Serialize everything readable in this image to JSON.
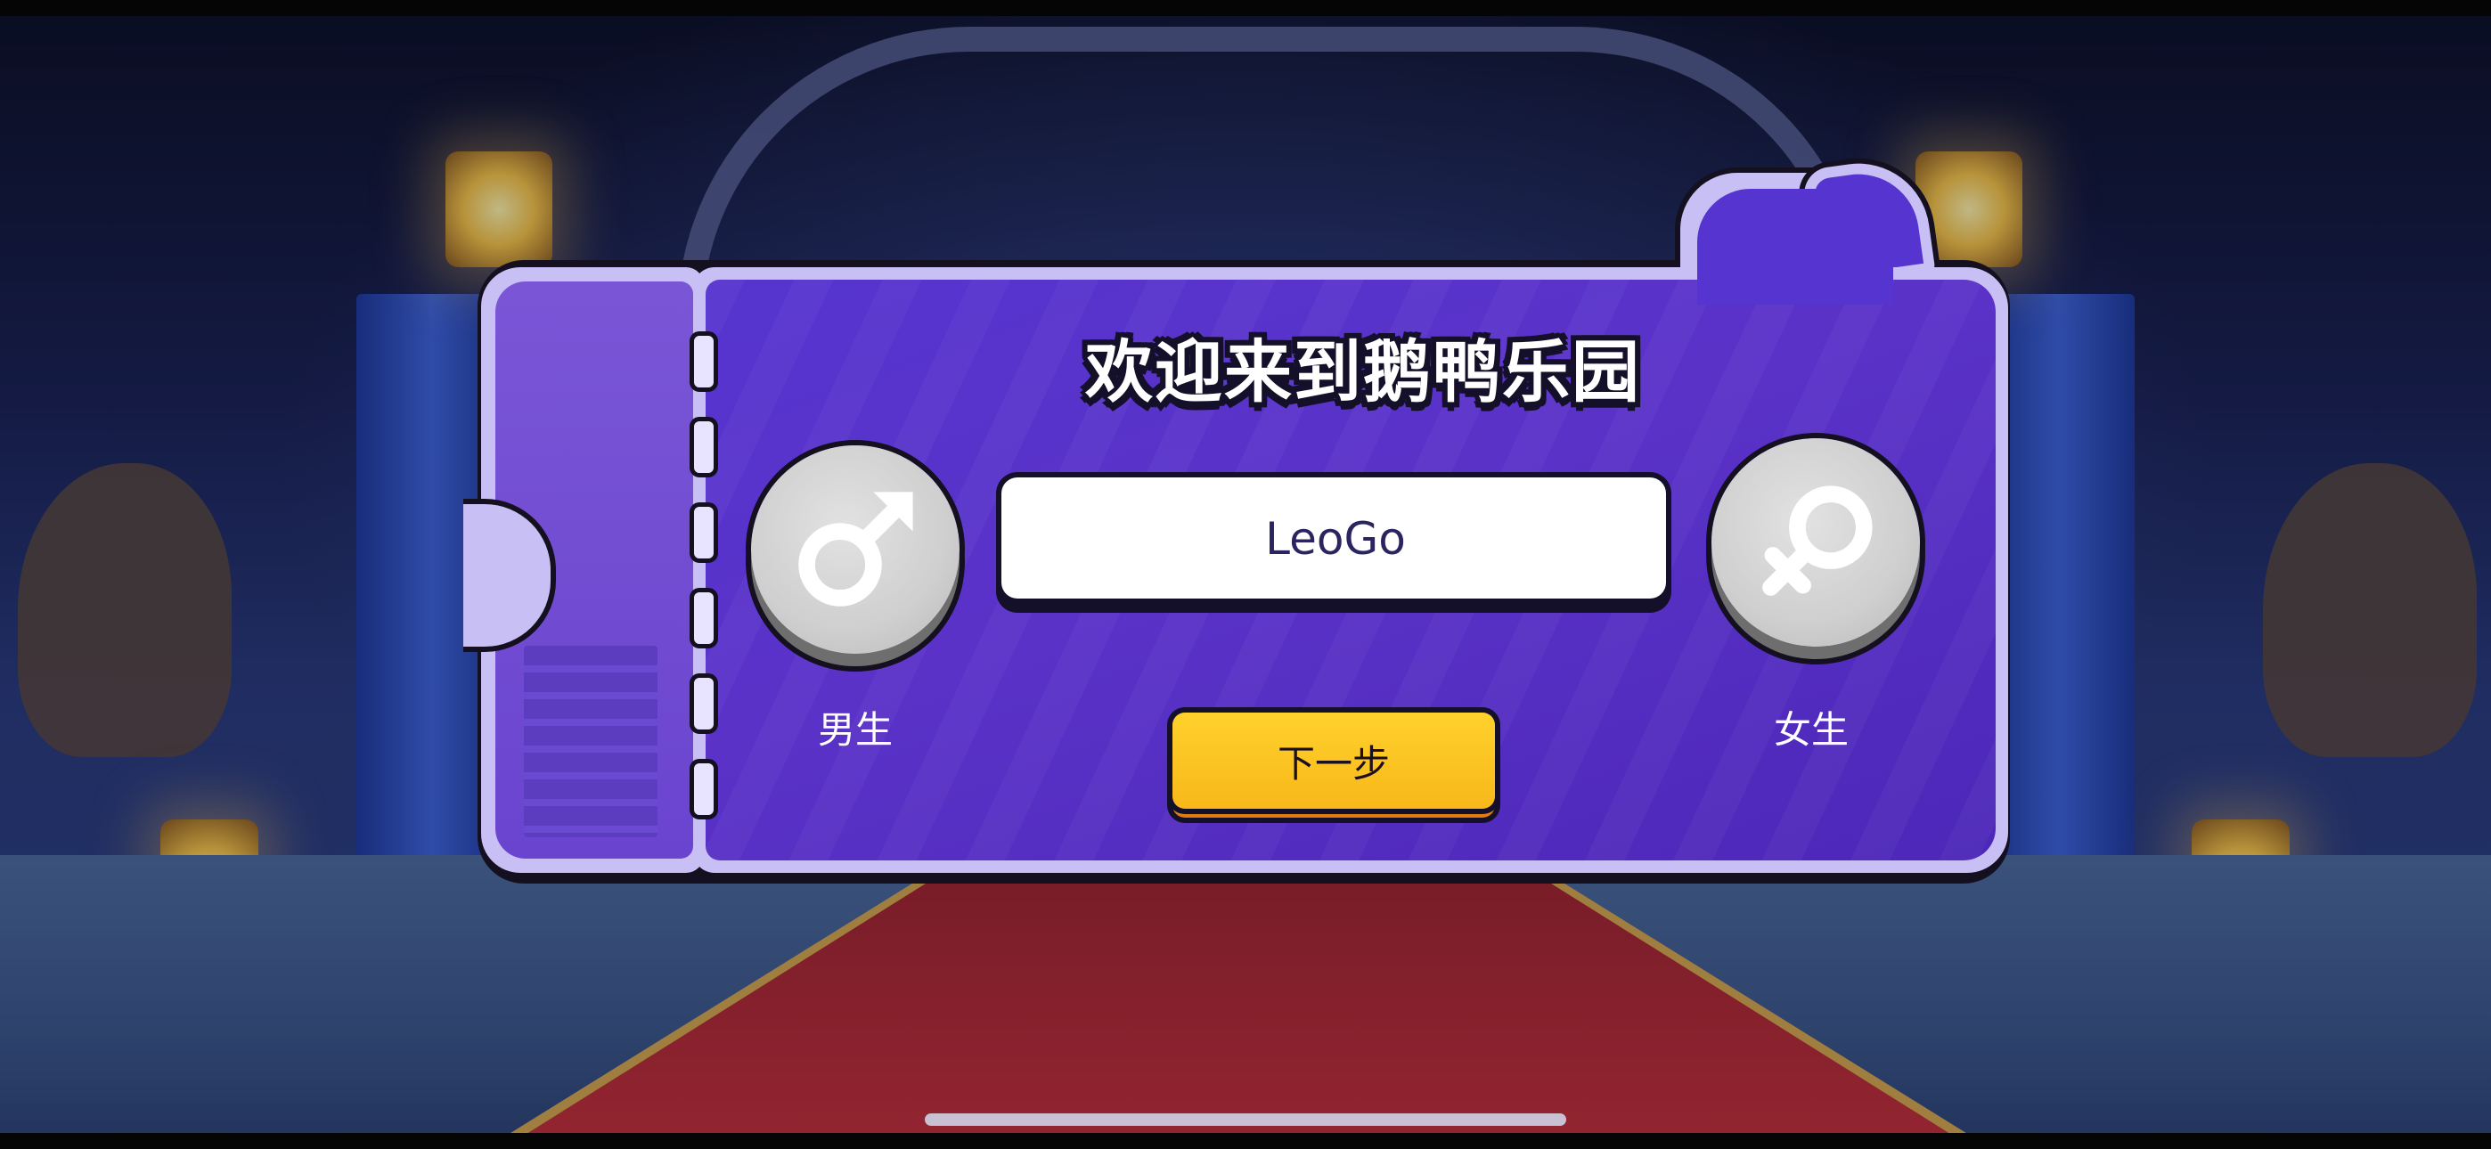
{
  "title": "欢迎来到鹅鸭乐园",
  "name_input": {
    "value": "LeoGo",
    "placeholder": ""
  },
  "gender": {
    "male_label": "男生",
    "female_label": "女生",
    "male_icon": "male-symbol-icon",
    "female_icon": "female-symbol-icon"
  },
  "next_button": {
    "label": "下一步"
  },
  "colors": {
    "panel": "#5634cf",
    "panel_border": "#c8c0f4",
    "button": "#ffc61f",
    "gender_button": "#d4d4d4",
    "outline": "#15102a"
  }
}
